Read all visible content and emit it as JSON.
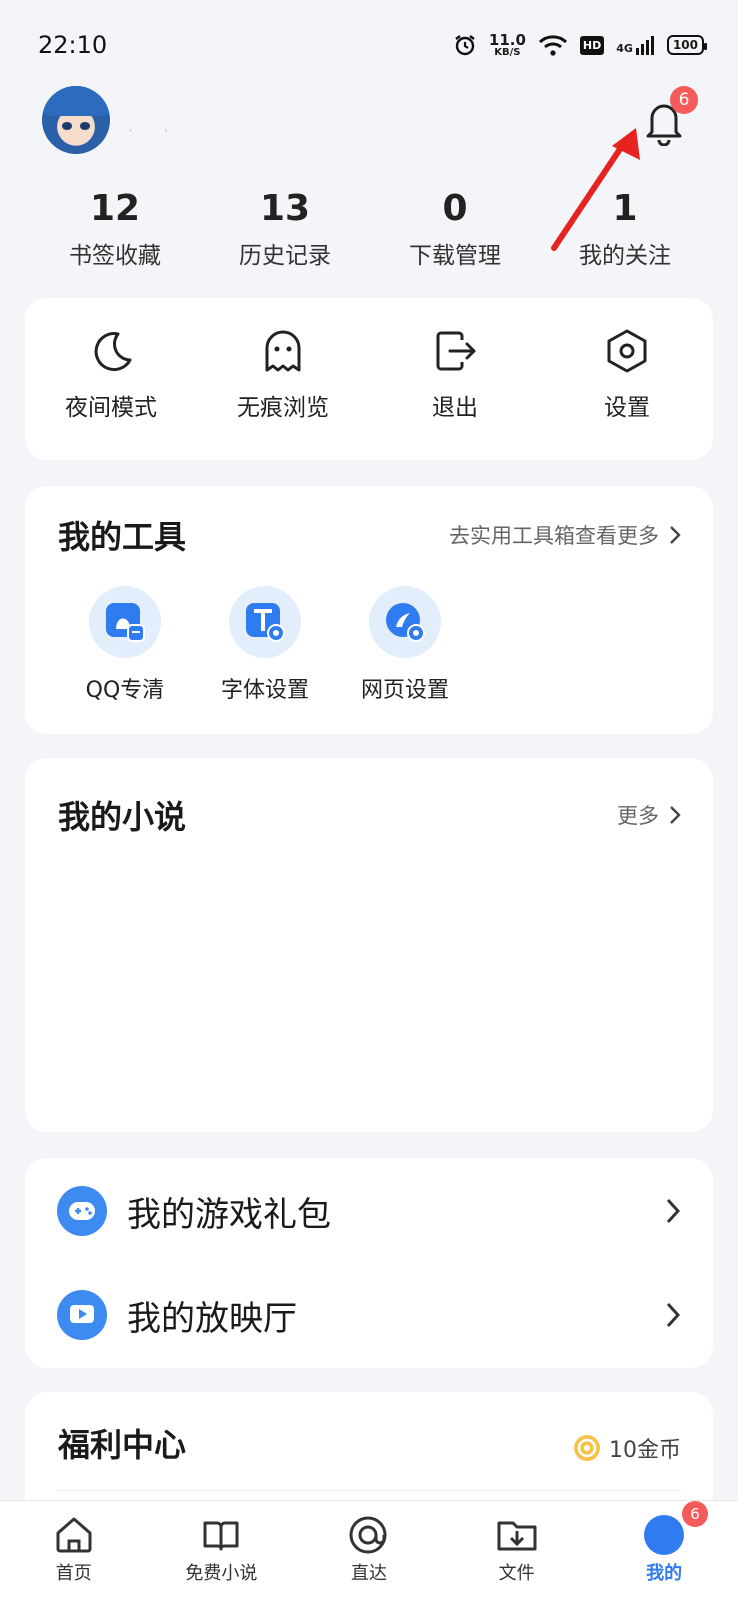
{
  "status_bar": {
    "time": "22:10",
    "speed_value": "11.0",
    "speed_unit": "KB/S",
    "hd": "HD",
    "network": "4G",
    "battery": "100"
  },
  "profile": {
    "username": "·    ·",
    "notification_count": "6"
  },
  "stats": [
    {
      "value": "12",
      "label": "书签收藏"
    },
    {
      "value": "13",
      "label": "历史记录"
    },
    {
      "value": "0",
      "label": "下载管理"
    },
    {
      "value": "1",
      "label": "我的关注"
    }
  ],
  "quick_actions": [
    {
      "label": "夜间模式",
      "icon": "moon-icon"
    },
    {
      "label": "无痕浏览",
      "icon": "ghost-icon"
    },
    {
      "label": "退出",
      "icon": "logout-icon"
    },
    {
      "label": "设置",
      "icon": "settings-icon"
    }
  ],
  "tools_card": {
    "title": "我的工具",
    "more": "去实用工具箱查看更多",
    "items": [
      {
        "label": "QQ专清",
        "icon": "qq-clean-icon"
      },
      {
        "label": "字体设置",
        "icon": "font-settings-icon"
      },
      {
        "label": "网页设置",
        "icon": "webpage-settings-icon"
      }
    ]
  },
  "novel_card": {
    "title": "我的小说",
    "more": "更多"
  },
  "list_card": {
    "items": [
      {
        "label": "我的游戏礼包",
        "icon": "game-controller-icon"
      },
      {
        "label": "我的放映厅",
        "icon": "play-icon"
      }
    ]
  },
  "welfare_card": {
    "title": "福利中心",
    "coins": "10金币"
  },
  "bottom_nav": {
    "items": [
      {
        "label": "首页",
        "icon": "home-icon"
      },
      {
        "label": "免费小说",
        "icon": "book-icon"
      },
      {
        "label": "直达",
        "icon": "direct-icon"
      },
      {
        "label": "文件",
        "icon": "file-icon"
      },
      {
        "label": "我的",
        "icon": "me-icon"
      }
    ],
    "me_badge": "6"
  },
  "colors": {
    "accent": "#2f7bf0",
    "badge": "#f45b5b",
    "arrow": "#e8231f",
    "background": "#f3f5f9"
  }
}
